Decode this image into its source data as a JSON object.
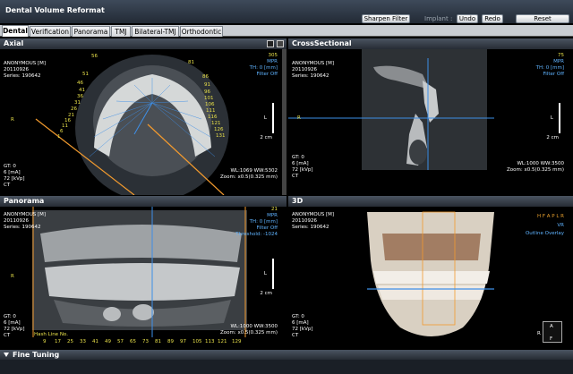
{
  "app": {
    "title": "Dental Volume Reformat"
  },
  "toolbar": {
    "sharpen": "Sharpen Filter",
    "implant": "Implant :",
    "undo": "Undo",
    "redo": "Redo",
    "reset": "Reset"
  },
  "tabs": [
    "Dental",
    "Verification",
    "Panorama",
    "TMJ",
    "Bilateral-TMJ",
    "Orthodontic"
  ],
  "axial": {
    "title": "Axial",
    "patient": "ANONYMOUS [M]",
    "date": "20110926",
    "series": "Series: 190642",
    "top_right": [
      "305",
      "MPR",
      "TH: 0 [mm]",
      "Filter Off"
    ],
    "left_label": "R",
    "right_label": "L",
    "scale": "2 cm",
    "bottom_left": [
      "GT: 0",
      "6 [mA]",
      "72 [kVp]",
      "CT"
    ],
    "bottom_right": [
      "WL:1069 WW:5302",
      "Zoom: x0.5(0.325 mm)"
    ],
    "hash_top": [
      "56",
      "81"
    ],
    "hash_left": [
      "51",
      "46",
      "41",
      "36",
      "31",
      "26",
      "21",
      "16",
      "11",
      "6",
      "1"
    ],
    "hash_right": [
      "86",
      "91",
      "96",
      "101",
      "106",
      "111",
      "116",
      "121",
      "126",
      "131"
    ]
  },
  "cross": {
    "title": "CrossSectional",
    "patient": "ANONYMOUS [M]",
    "date": "20110926",
    "series": "Series: 190642",
    "top_right": [
      "75",
      "MPR",
      "TH: 0 [mm]",
      "Filter Off"
    ],
    "left_label": "R",
    "right_label": "L",
    "scale": "2 cm",
    "bottom_left": [
      "GT: 0",
      "6 [mA]",
      "72 [kVp]",
      "CT"
    ],
    "bottom_right": [
      "WL:1000 WW:3500",
      "Zoom: x0.5(0.325 mm)"
    ]
  },
  "pano": {
    "title": "Panorama",
    "patient": "ANONYMOUS [M]",
    "date": "20110926",
    "series": "Series: 190642",
    "top_right": [
      "21",
      "MPR",
      "TH: 0 [mm]",
      "Filter Off",
      "Threshold: -1024"
    ],
    "left_label": "R",
    "right_label": "L",
    "scale": "2 cm",
    "bottom_left": [
      "GT: 0",
      "6 [mA]",
      "72 [kVp]",
      "CT"
    ],
    "bottom_right": [
      "WL:1000 WW:3500",
      "Zoom: x0.5(0.325 mm)"
    ],
    "hash_label": "Hash Line No.",
    "hash_numbers": [
      "9",
      "17",
      "25",
      "33",
      "41",
      "49",
      "57",
      "65",
      "73",
      "81",
      "89",
      "97",
      "105",
      "113",
      "121",
      "129"
    ]
  },
  "v3d": {
    "title": "3D",
    "patient": "ANONYMOUS [M]",
    "date": "20110926",
    "series": "Series: 190642",
    "top_right": [
      "H F A P L R",
      "VR",
      "Outline Overlay"
    ],
    "bottom_left": [
      "GT: 0",
      "6 [mA]",
      "72 [kVp]",
      "CT"
    ],
    "orient": {
      "a": "A",
      "r": "R",
      "f": "F"
    }
  },
  "fine_tuning": "Fine Tuning"
}
